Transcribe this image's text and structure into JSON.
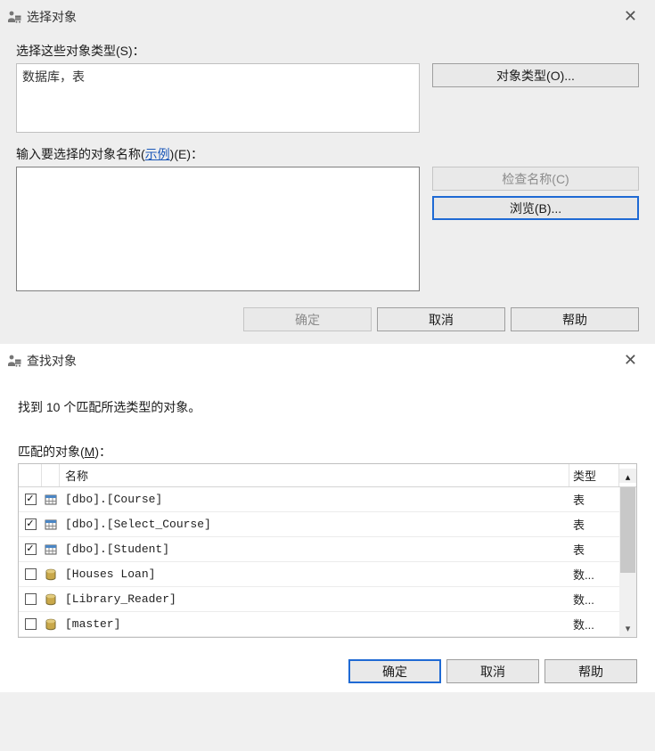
{
  "dialog1": {
    "title": "选择对象",
    "select_types_label": "选择这些对象类型(S)：",
    "types_value": "数据库，表",
    "object_types_btn": "对象类型(O)...",
    "enter_name_prefix": "输入要选择的对象名称(",
    "example_link": "示例",
    "enter_name_suffix": ")(E)：",
    "check_names_btn": "检查名称(C)",
    "browse_btn": "浏览(B)...",
    "ok_btn": "确定",
    "cancel_btn": "取消",
    "help_btn": "帮助"
  },
  "dialog2": {
    "title": "查找对象",
    "found_line": "找到 10 个匹配所选类型的对象。",
    "match_label_prefix": "匹配的对象(",
    "match_label_mn": "M",
    "match_label_suffix": ")：",
    "name_header": "名称",
    "type_header": "类型",
    "rows": [
      {
        "checked": true,
        "icon": "table",
        "name": "[dbo].[Course]",
        "type": "表"
      },
      {
        "checked": true,
        "icon": "table",
        "name": "[dbo].[Select_Course]",
        "type": "表"
      },
      {
        "checked": true,
        "icon": "table",
        "name": "[dbo].[Student]",
        "type": "表"
      },
      {
        "checked": false,
        "icon": "db",
        "name": "[Houses Loan]",
        "type": "数..."
      },
      {
        "checked": false,
        "icon": "db",
        "name": "[Library_Reader]",
        "type": "数..."
      },
      {
        "checked": false,
        "icon": "db",
        "name": "[master]",
        "type": "数..."
      }
    ],
    "ok_btn": "确定",
    "cancel_btn": "取消",
    "help_btn": "帮助"
  }
}
